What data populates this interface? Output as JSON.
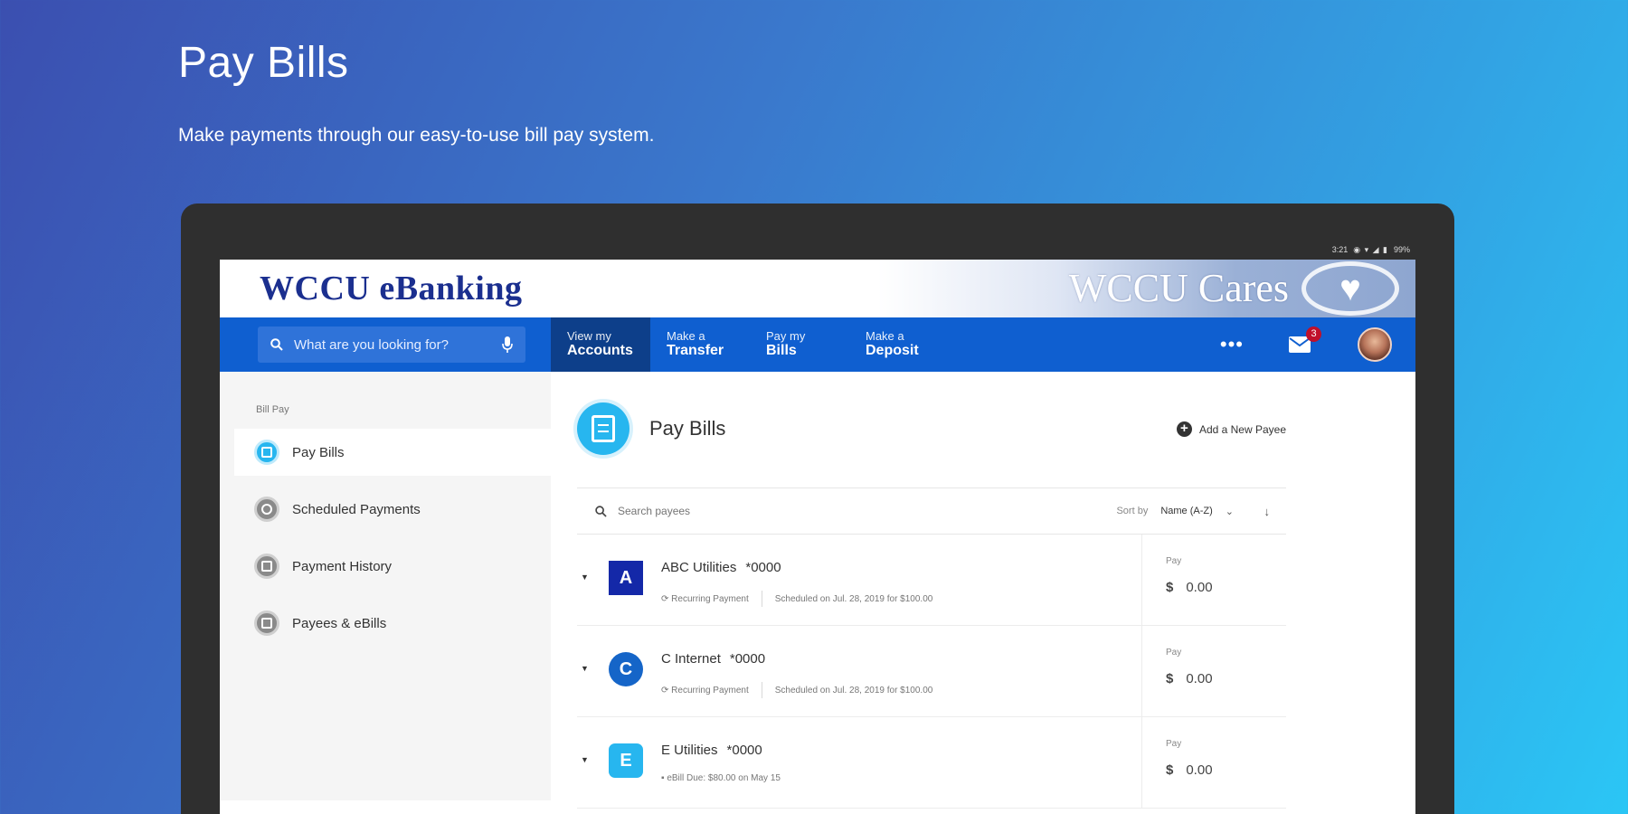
{
  "hero": {
    "title": "Pay Bills",
    "subtitle": "Make payments through our easy-to-use bill pay system."
  },
  "statusbar": {
    "time": "3:21",
    "battery": "99%"
  },
  "banner": {
    "logo_text": "WCCU eBanking",
    "cares_text": "WCCU Cares"
  },
  "nav": {
    "search_placeholder": "What are you looking for?",
    "items": [
      {
        "top": "View my",
        "bottom": "Accounts",
        "active": true
      },
      {
        "top": "Make a",
        "bottom": "Transfer",
        "active": false
      },
      {
        "top": "Pay my",
        "bottom": "Bills",
        "active": false
      },
      {
        "top": "Make a",
        "bottom": "Deposit",
        "active": false
      }
    ],
    "more_label": "•••",
    "mail_count": "3"
  },
  "sidebar": {
    "section_label": "Bill Pay",
    "items": [
      {
        "label": "Pay Bills",
        "icon": "bill-icon",
        "active": true
      },
      {
        "label": "Scheduled Payments",
        "icon": "clock-icon",
        "active": false
      },
      {
        "label": "Payment History",
        "icon": "calendar-icon",
        "active": false
      },
      {
        "label": "Payees & eBills",
        "icon": "list-icon",
        "active": false
      }
    ]
  },
  "main": {
    "title": "Pay Bills",
    "add_payee_label": "Add a New Payee",
    "search_placeholder": "Search payees",
    "sort_label": "Sort by",
    "sort_value": "Name (A-Z)",
    "payees": [
      {
        "logo": "A",
        "logo_shape": "square",
        "name": "ABC Utilities",
        "account": "*0000",
        "meta1": "⟳ Recurring Payment",
        "meta2": "Scheduled on Jul. 28, 2019 for $100.00",
        "pay_label": "Pay",
        "currency": "$",
        "amount": "0.00"
      },
      {
        "logo": "C",
        "logo_shape": "circle",
        "name": "C Internet",
        "account": "*0000",
        "meta1": "⟳ Recurring Payment",
        "meta2": "Scheduled on Jul. 28, 2019 for $100.00",
        "pay_label": "Pay",
        "currency": "$",
        "amount": "0.00"
      },
      {
        "logo": "E",
        "logo_shape": "rounded",
        "name": "E Utilities",
        "account": "*0000",
        "meta1": "▪ eBill Due: $80.00 on May 15",
        "meta2": "",
        "pay_label": "Pay",
        "currency": "$",
        "amount": "0.00"
      }
    ]
  }
}
